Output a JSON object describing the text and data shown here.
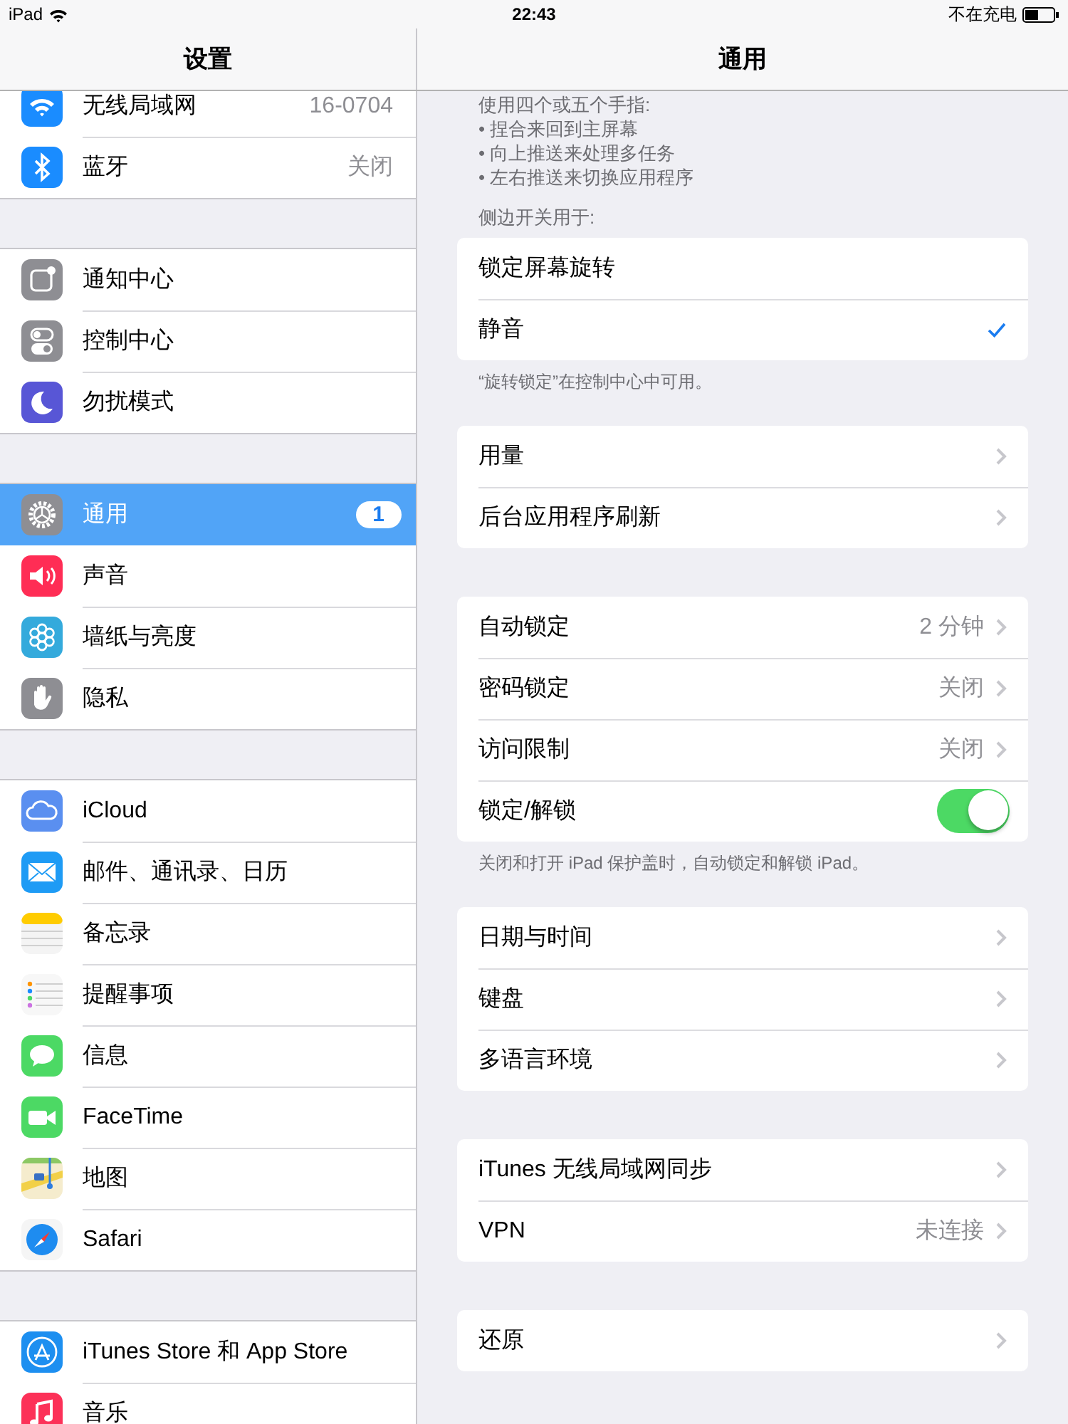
{
  "status_bar": {
    "device": "iPad",
    "time": "22:43",
    "charging": "不在充电"
  },
  "sidebar": {
    "title": "设置",
    "groups": [
      [
        {
          "label": "无线局域网",
          "value": "16-0704",
          "selected": false
        },
        {
          "label": "蓝牙",
          "value": "关闭",
          "selected": false
        }
      ],
      [
        {
          "label": "通知中心",
          "selected": false
        },
        {
          "label": "控制中心",
          "selected": false
        },
        {
          "label": "勿扰模式",
          "selected": false
        }
      ],
      [
        {
          "label": "通用",
          "badge": "1",
          "selected": true
        },
        {
          "label": "声音",
          "selected": false
        },
        {
          "label": "墙纸与亮度",
          "selected": false
        },
        {
          "label": "隐私",
          "selected": false
        }
      ],
      [
        {
          "label": "iCloud",
          "selected": false
        },
        {
          "label": "邮件、通讯录、日历",
          "selected": false
        },
        {
          "label": "备忘录",
          "selected": false
        },
        {
          "label": "提醒事项",
          "selected": false
        },
        {
          "label": "信息",
          "selected": false
        },
        {
          "label": "FaceTime",
          "selected": false
        },
        {
          "label": "地图",
          "selected": false
        },
        {
          "label": "Safari",
          "selected": false
        }
      ],
      [
        {
          "label": "iTunes Store 和 App Store",
          "selected": false
        },
        {
          "label": "音乐",
          "selected": false
        }
      ]
    ]
  },
  "detail": {
    "title": "通用",
    "intro": "使用四个或五个手指:",
    "bullets": [
      "• 捏合来回到主屏幕",
      "• 向上推送来处理多任务",
      "• 左右推送来切换应用程序"
    ],
    "sections": [
      {
        "header": "侧边开关用于:",
        "rows": [
          {
            "kind": "check",
            "label": "锁定屏幕旋转",
            "checked": false
          },
          {
            "kind": "check",
            "label": "静音",
            "checked": true
          }
        ],
        "footer": "“旋转锁定”在控制中心中可用。"
      },
      {
        "rows": [
          {
            "kind": "link",
            "label": "用量"
          },
          {
            "kind": "link",
            "label": "后台应用程序刷新"
          }
        ]
      },
      {
        "rows": [
          {
            "kind": "link",
            "label": "自动锁定",
            "value": "2 分钟"
          },
          {
            "kind": "link",
            "label": "密码锁定",
            "value": "关闭"
          },
          {
            "kind": "link",
            "label": "访问限制",
            "value": "关闭"
          },
          {
            "kind": "toggle",
            "label": "锁定/解锁",
            "on": true
          }
        ],
        "footer": "关闭和打开 iPad 保护盖时，自动锁定和解锁 iPad。"
      },
      {
        "rows": [
          {
            "kind": "link",
            "label": "日期与时间"
          },
          {
            "kind": "link",
            "label": "键盘"
          },
          {
            "kind": "link",
            "label": "多语言环境"
          }
        ]
      },
      {
        "rows": [
          {
            "kind": "link",
            "label": "iTunes 无线局域网同步"
          },
          {
            "kind": "link",
            "label": "VPN",
            "value": "未连接"
          }
        ]
      },
      {
        "rows": [
          {
            "kind": "link",
            "label": "还原"
          }
        ]
      }
    ]
  }
}
